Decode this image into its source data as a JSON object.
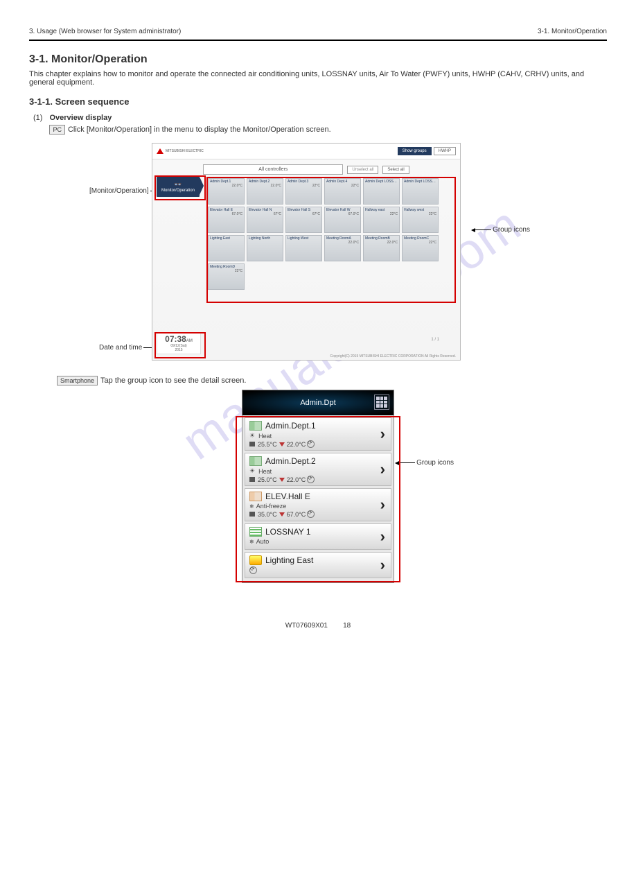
{
  "header": {
    "left": "3. Usage (Web browser for System administrator)",
    "right": "3-1. Monitor/Operation"
  },
  "h2": "3-1. Monitor/Operation",
  "sub": "This chapter explains how to monitor and operate the connected air conditioning units, LOSSNAY units, Air To Water (PWFY) units, HWHP (CAHV, CRHV) units, and general equipment.",
  "h3_1": "3-1-1. Screen sequence",
  "step": {
    "num": "(1)",
    "title": "Overview display",
    "desc": "Click [Monitor/Operation] in the menu to display the Monitor/Operation screen.",
    "desc_sm": "Tap the group icon to see the detail screen."
  },
  "pc": {
    "caption_left": "[Monitor/Operation]",
    "caption_right": "Group icons",
    "caption_clock": "Date and time",
    "brand": "MITSUBISHI\nELECTRIC",
    "buttons": {
      "show": "Show groups",
      "hwhp": "HWHP",
      "unsel": "Unselect all",
      "selall": "Select all"
    },
    "controller_label": "Controller",
    "dropdown": "All controllers",
    "nav": "Monitor/Operation",
    "page": "1 / 1",
    "copyright": "Copyright(C) 2015 MITSUBISHI ELECTRIC CORPORATION All Rights Reserved.",
    "clock": {
      "time": "07:38",
      "ampm": "AM",
      "date": "09/12(Sat)",
      "year": "2015"
    },
    "cells": [
      {
        "n": "Admin Dept.1",
        "t": "22.0°C"
      },
      {
        "n": "Admin Dept.2",
        "t": "22.0°C"
      },
      {
        "n": "Admin Dept.3",
        "t": "22°C"
      },
      {
        "n": "Admin Dept.4",
        "t": "22°C"
      },
      {
        "n": "Admin Dept LOSS…",
        "t": ""
      },
      {
        "n": "Admin Dept LOSS…",
        "t": ""
      },
      {
        "n": "Elevator Hall E",
        "t": "67.0°C"
      },
      {
        "n": "Elevator Hall N",
        "t": "67°C"
      },
      {
        "n": "Elevator Hall S",
        "t": "67°C"
      },
      {
        "n": "Elevator Hall W",
        "t": "67.0°C"
      },
      {
        "n": "Hallway east",
        "t": "22°C"
      },
      {
        "n": "Hallway west",
        "t": "22°C"
      },
      {
        "n": "Lighting East",
        "t": ""
      },
      {
        "n": "Lighting North",
        "t": ""
      },
      {
        "n": "Lighting West",
        "t": ""
      },
      {
        "n": "Meeting RoomA",
        "t": "22.0°C"
      },
      {
        "n": "Meeting RoomB",
        "t": "22.0°C"
      },
      {
        "n": "Meeting RoomC",
        "t": "22°C"
      },
      {
        "n": "Meeting RoomD",
        "t": "22°C"
      }
    ]
  },
  "phone": {
    "title": "Admin.Dpt",
    "caption_right": "Group icons",
    "items": [
      {
        "name": "Admin.Dept.1",
        "mode": "Heat",
        "r1": "25.5°C",
        "r2": "22.0°C",
        "ico": "ac"
      },
      {
        "name": "Admin.Dept.2",
        "mode": "Heat",
        "r1": "25.0°C",
        "r2": "22.0°C",
        "ico": "ac"
      },
      {
        "name": "ELEV.Hall E",
        "mode": "Anti-freeze",
        "r1": "35.0°C",
        "r2": "67.0°C",
        "ico": "ht"
      },
      {
        "name": "LOSSNAY 1",
        "mode": "Auto",
        "r1": "",
        "r2": "",
        "ico": "ln"
      },
      {
        "name": "Lighting East",
        "mode": "",
        "r1": "",
        "r2": "",
        "ico": "lt"
      }
    ]
  },
  "labels": {
    "pc_cap": "PC",
    "sm_cap": "Smartphone",
    "pagenum": "18",
    "manual": "WT07609X01"
  }
}
